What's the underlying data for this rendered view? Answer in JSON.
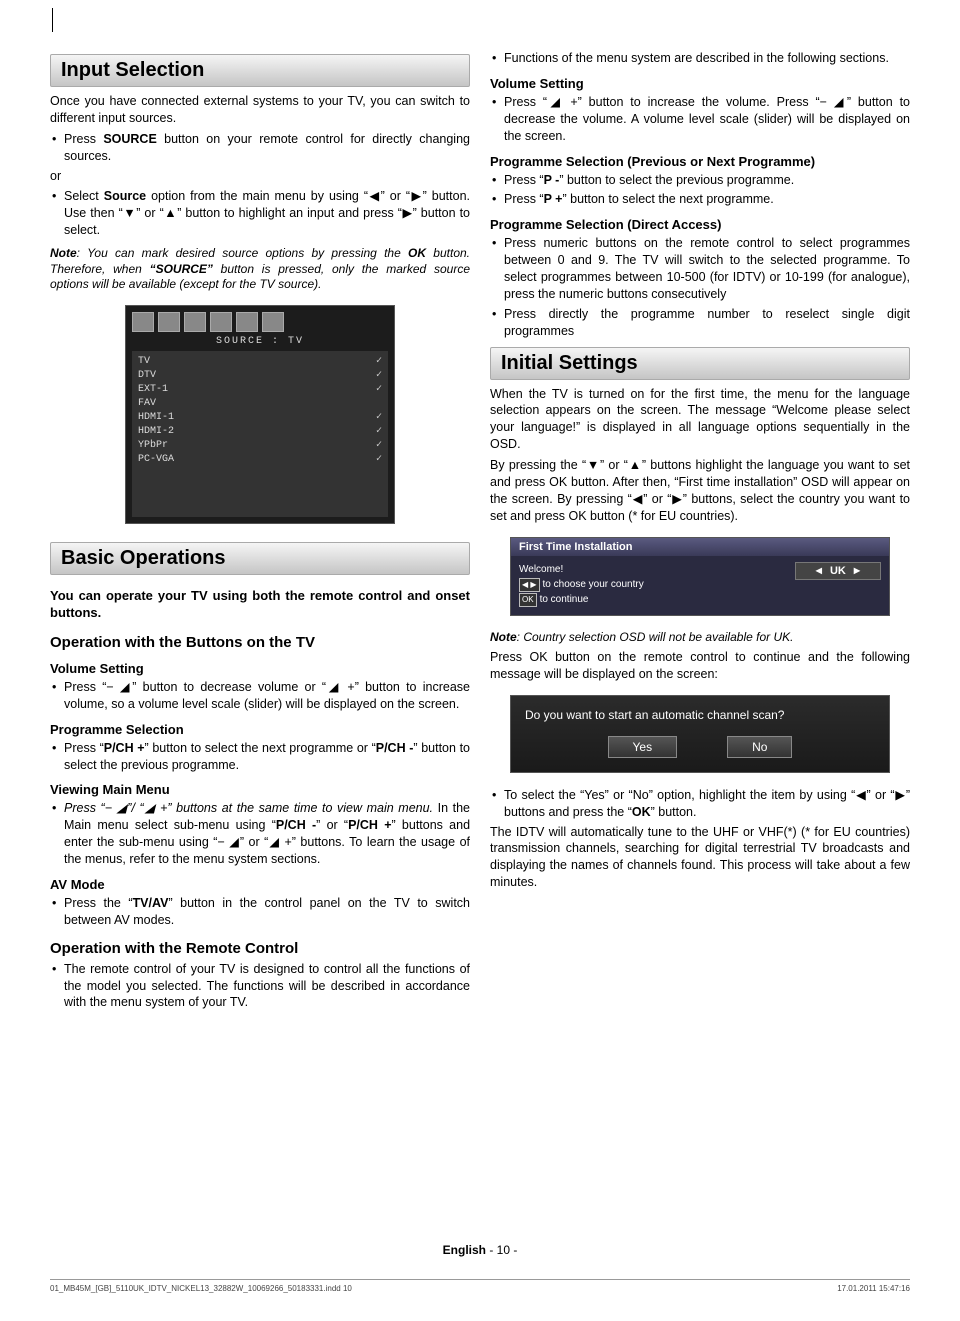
{
  "left": {
    "h_input": "Input Selection",
    "p_input1": "Once you have connected external systems to your TV, you can switch to different input sources.",
    "li_input1_a": "Press ",
    "li_input1_b": "SOURCE",
    "li_input1_c": " button on your remote control for directly changing sources.",
    "or": "or",
    "li_input2_a": "Select ",
    "li_input2_b": "Source",
    "li_input2_c": " option from the main menu by using “◀” or “▶” button. Use then “▼” or “▲” button to highlight an input and press “▶” button to select.",
    "note1_a": "Note",
    "note1_b": ": You can mark desired source options by pressing the ",
    "note1_c": "OK",
    "note1_d": " button. Therefore, when ",
    "note1_e": "“SOURCE”",
    "note1_f": " button is pressed, only the marked source options will be available (except for the TV source).",
    "osd_label": "SOURCE : TV",
    "osd_items": [
      "TV",
      "DTV",
      "EXT-1",
      "FAV",
      "HDMI-1",
      "HDMI-2",
      "YPbPr",
      "PC-VGA"
    ],
    "h_basic": "Basic Operations",
    "p_basic_lead": "You can operate your TV using both the remote control and onset buttons.",
    "h_opbtn": "Operation with the Buttons on the TV",
    "h_vol": "Volume Setting",
    "li_vol": "Press “− ◢” button to decrease volume or “◢ +” button to increase volume, so a volume level scale (slider) will be displayed on the screen.",
    "h_prog": "Programme Selection",
    "li_prog_a": "Press “",
    "li_prog_b": "P/CH +",
    "li_prog_c": "” button to select the next programme or “",
    "li_prog_d": "P/CH -",
    "li_prog_e": "” button to select the previous programme.",
    "h_view": "Viewing Main Menu",
    "li_view_a": "Press “− ◢”/ “◢ +” buttons at the same time to view main menu.",
    "li_view_b": " In the Main menu select sub-menu using “",
    "li_view_c": "P/CH -",
    "li_view_d": "” or “",
    "li_view_e": "P/CH +",
    "li_view_f": "” buttons and enter the sub-menu using “− ◢” or “◢ +” buttons. To learn the usage of the menus, refer to the menu system sections.",
    "h_av": "AV Mode",
    "li_av_a": "Press the “",
    "li_av_b": "TV/AV",
    "li_av_c": "” button in the control panel on the TV to switch between AV modes.",
    "h_oprc": "Operation with the Remote Control",
    "li_oprc": "The remote control of your TV is designed to control all the functions of the model you selected. The functions will be described in accordance with the menu system of your TV."
  },
  "right": {
    "li_funcs": "Functions of the menu system are described in the following sections.",
    "h_vol": "Volume Setting",
    "li_vol": "Press “◢ +” button to increase the volume. Press “− ◢” button to decrease the volume. A volume level scale (slider) will be displayed on the screen.",
    "h_progsel": "Programme Selection (Previous or Next Programme)",
    "li_pminus_a": "Press “",
    "li_pminus_b": "P -",
    "li_pminus_c": "” button to select the previous programme.",
    "li_pplus_a": "Press “",
    "li_pplus_b": "P +",
    "li_pplus_c": "” button to select the next programme.",
    "h_direct": "Programme Selection (Direct Access)",
    "li_direct1": "Press numeric buttons on the remote control to select programmes between 0 and 9. The TV will switch to the selected programme. To select programmes between 10-500 (for IDTV) or 10-199 (for analogue), press the numeric buttons consecutively",
    "li_direct2": "Press directly the programme number to reselect single digit programmes",
    "h_initial": "Initial Settings",
    "p_initial1": "When the TV is turned on for the first time, the menu for the language selection appears on the screen. The message “Welcome please select your language!” is displayed in all language options sequentially in the OSD.",
    "p_initial2": "By pressing the “▼” or “▲” buttons highlight the language you want to set and press OK button. After then, “First time installation” OSD will appear on the screen. By pressing “◀” or “▶” buttons, select the country you want to set and press OK button (* for EU countries).",
    "osd_install_title": "First Time Installation",
    "osd_install_welcome": "Welcome!",
    "osd_install_l1": "to choose your country",
    "osd_install_l2": "to continue",
    "osd_install_uk": "UK",
    "note2_a": "Note",
    "note2_b": ": Country selection OSD will not be available for UK.",
    "p_pressok": "Press OK button on the remote control to continue and the following message will be displayed on the screen:",
    "osd_scan_q": "Do you want to start an automatic channel scan?",
    "osd_yes": "Yes",
    "osd_no": "No",
    "li_yesno_a": "To select the “Yes” or “No” option, highlight the item by using “◀” or “▶” buttons and press the “",
    "li_yesno_b": "OK",
    "li_yesno_c": "” button.",
    "p_idtv": "The IDTV will automatically tune to the UHF or VHF(*) (* for EU countries) transmission channels, searching for digital terrestrial TV broadcasts and displaying the names of channels found. This process will take about a few minutes."
  },
  "footer_lang": "English",
  "footer_page": "  - 10 -",
  "indd_left": "01_MB45M_[GB]_5110UK_IDTV_NICKEL13_32882W_10069266_50183331.indd   10",
  "indd_right": "17.01.2011   15:47:16"
}
